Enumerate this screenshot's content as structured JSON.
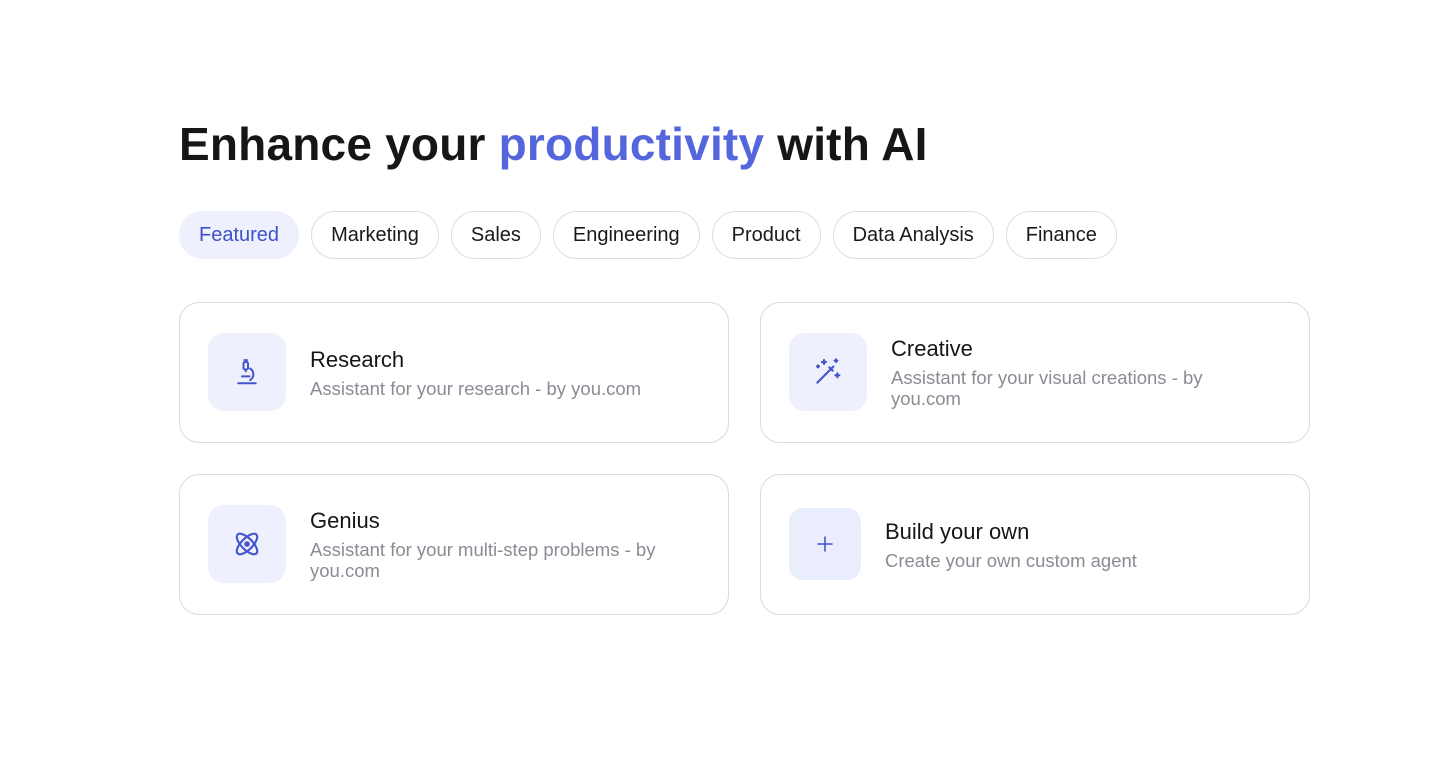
{
  "heading": {
    "before": "Enhance your ",
    "accent": "productivity",
    "after": " with AI"
  },
  "filters": [
    {
      "label": "Featured",
      "active": true
    },
    {
      "label": "Marketing",
      "active": false
    },
    {
      "label": "Sales",
      "active": false
    },
    {
      "label": "Engineering",
      "active": false
    },
    {
      "label": "Product",
      "active": false
    },
    {
      "label": "Data Analysis",
      "active": false
    },
    {
      "label": "Finance",
      "active": false
    }
  ],
  "agents": [
    {
      "title": "Research",
      "description": "Assistant for your research - by you.com",
      "icon": "microscope-icon"
    },
    {
      "title": "Creative",
      "description": "Assistant for your visual creations - by you.com",
      "icon": "magic-wand-icon"
    },
    {
      "title": "Genius",
      "description": "Assistant for your multi-step problems - by you.com",
      "icon": "atom-icon"
    },
    {
      "title": "Build your own",
      "description": "Create your own custom agent",
      "icon": "plus-icon"
    }
  ],
  "colors": {
    "accent": "#5466dc",
    "icon": "#4455cc",
    "active_chip_bg": "#eef1fd",
    "muted_text": "#8b8b95"
  }
}
